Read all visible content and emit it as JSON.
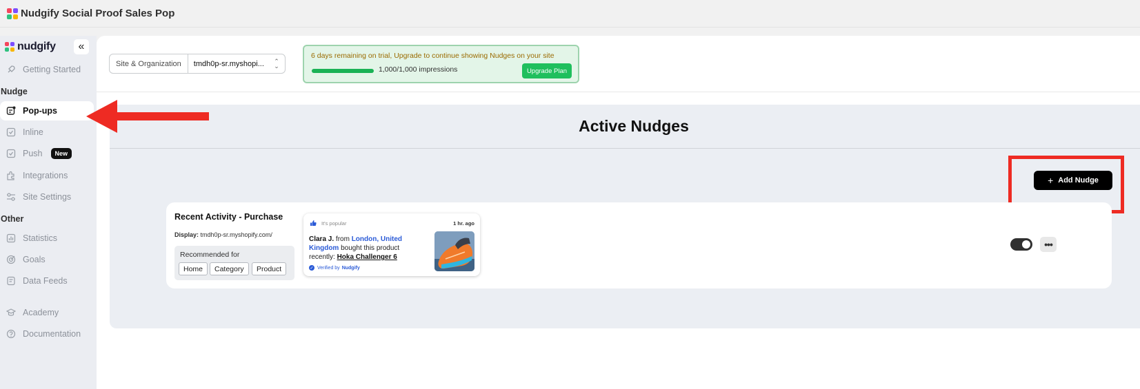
{
  "window": {
    "title": "Nudgify Social Proof Sales Pop"
  },
  "brand": {
    "name": "nudgify",
    "colors": [
      "#f5455c",
      "#7c4dff",
      "#2ec27e",
      "#f7b500"
    ]
  },
  "sidebar": {
    "collapse_icon": "double-chevron-left-icon",
    "items": [
      {
        "label": "Getting Started",
        "icon": "rocket-icon"
      },
      {
        "label": "Pop-ups",
        "icon": "popup-icon",
        "active": true
      },
      {
        "label": "Inline",
        "icon": "inline-icon"
      },
      {
        "label": "Push",
        "icon": "push-icon",
        "badge": "New"
      },
      {
        "label": "Integrations",
        "icon": "puzzle-icon"
      },
      {
        "label": "Site Settings",
        "icon": "sliders-icon"
      },
      {
        "label": "Statistics",
        "icon": "chart-icon"
      },
      {
        "label": "Goals",
        "icon": "target-icon"
      },
      {
        "label": "Data Feeds",
        "icon": "data-feed-icon"
      },
      {
        "label": "Academy",
        "icon": "graduation-cap-icon"
      },
      {
        "label": "Documentation",
        "icon": "help-circle-icon"
      }
    ],
    "sections": {
      "nudge": "Nudge",
      "other": "Other"
    }
  },
  "topbar": {
    "site_label": "Site & Organization",
    "site_value": "tmdh0p-sr.myshopi...",
    "trial_message": "6 days remaining on trial, Upgrade to continue showing Nudges on your site",
    "impressions": "1,000/1,000 impressions",
    "impressions_fraction": 1.0,
    "upgrade_label": "Upgrade Plan"
  },
  "main": {
    "heading": "Active Nudges",
    "add_button": "Add Nudge"
  },
  "nudge": {
    "title": "Recent Activity - Purchase",
    "display_label": "Display:",
    "display_value": "tmdh0p-sr.myshopify.com/",
    "recommended_label": "Recommended for",
    "tags": [
      "Home",
      "Category",
      "Product"
    ],
    "enabled": true,
    "preview": {
      "popular": "It's popular",
      "time": "1 hr. ago",
      "name": "Clara J.",
      "from": "from",
      "location": "London, United Kingdom",
      "action": "bought this product recently:",
      "product": "Hoka Challenger 6",
      "verified_prefix": "Verified by",
      "verified_brand": "Nudgify"
    }
  },
  "annotation_colors": {
    "red": "#ee2b23"
  }
}
